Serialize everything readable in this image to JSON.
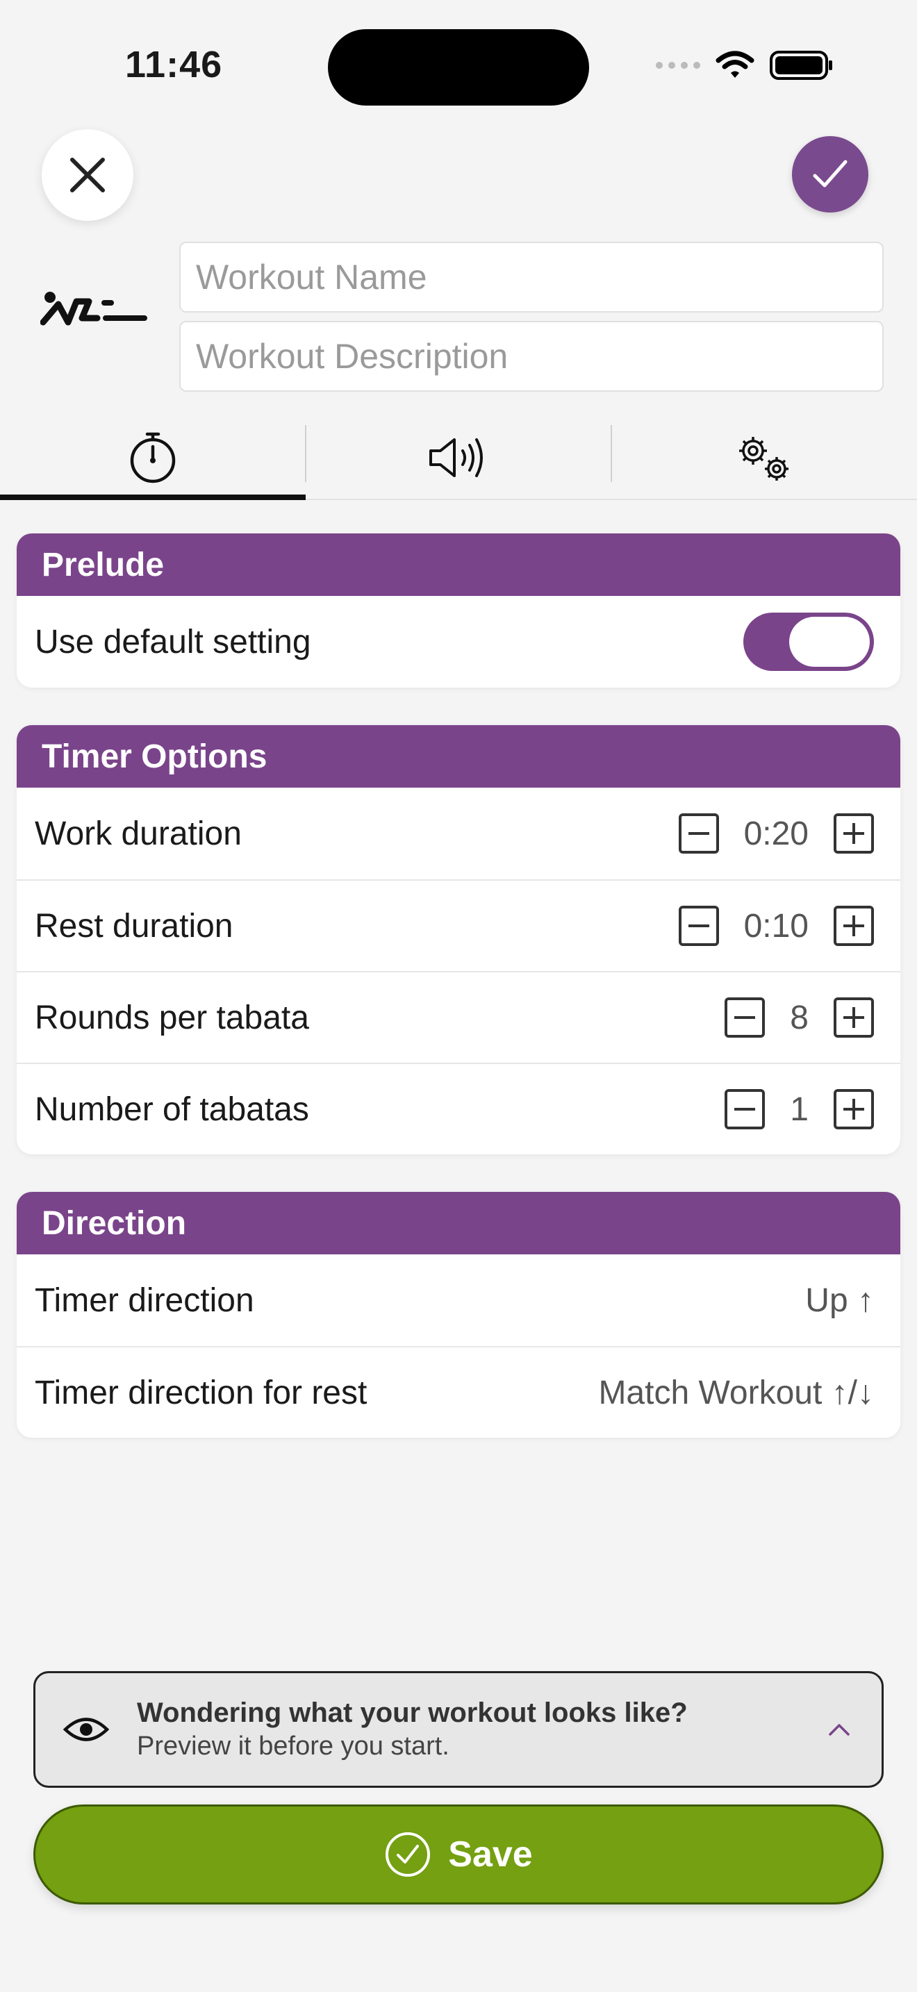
{
  "status_bar": {
    "time": "11:46"
  },
  "header": {
    "name_placeholder": "Workout Name",
    "description_placeholder": "Workout Description"
  },
  "tabs": [
    {
      "icon": "stopwatch-icon",
      "active": true
    },
    {
      "icon": "speaker-icon",
      "active": false
    },
    {
      "icon": "gears-icon",
      "active": false
    }
  ],
  "prelude": {
    "title": "Prelude",
    "rows": [
      {
        "label": "Use default setting",
        "toggle_on": true
      }
    ]
  },
  "timer_options": {
    "title": "Timer Options",
    "rows": [
      {
        "label": "Work duration",
        "value": "0:20"
      },
      {
        "label": "Rest duration",
        "value": "0:10"
      },
      {
        "label": "Rounds per tabata",
        "value": "8"
      },
      {
        "label": "Number of tabatas",
        "value": "1"
      }
    ]
  },
  "direction": {
    "title": "Direction",
    "rows": [
      {
        "label": "Timer direction",
        "value": "Up ↑"
      },
      {
        "label": "Timer direction for rest",
        "value": "Match Workout ↑/↓"
      }
    ]
  },
  "preview": {
    "title": "Wondering what your workout looks like?",
    "subtitle": "Preview it before you start."
  },
  "save": {
    "label": "Save"
  },
  "colors": {
    "accent_purple": "#7a448a",
    "save_green": "#74a011",
    "background": "#f4f4f4"
  }
}
